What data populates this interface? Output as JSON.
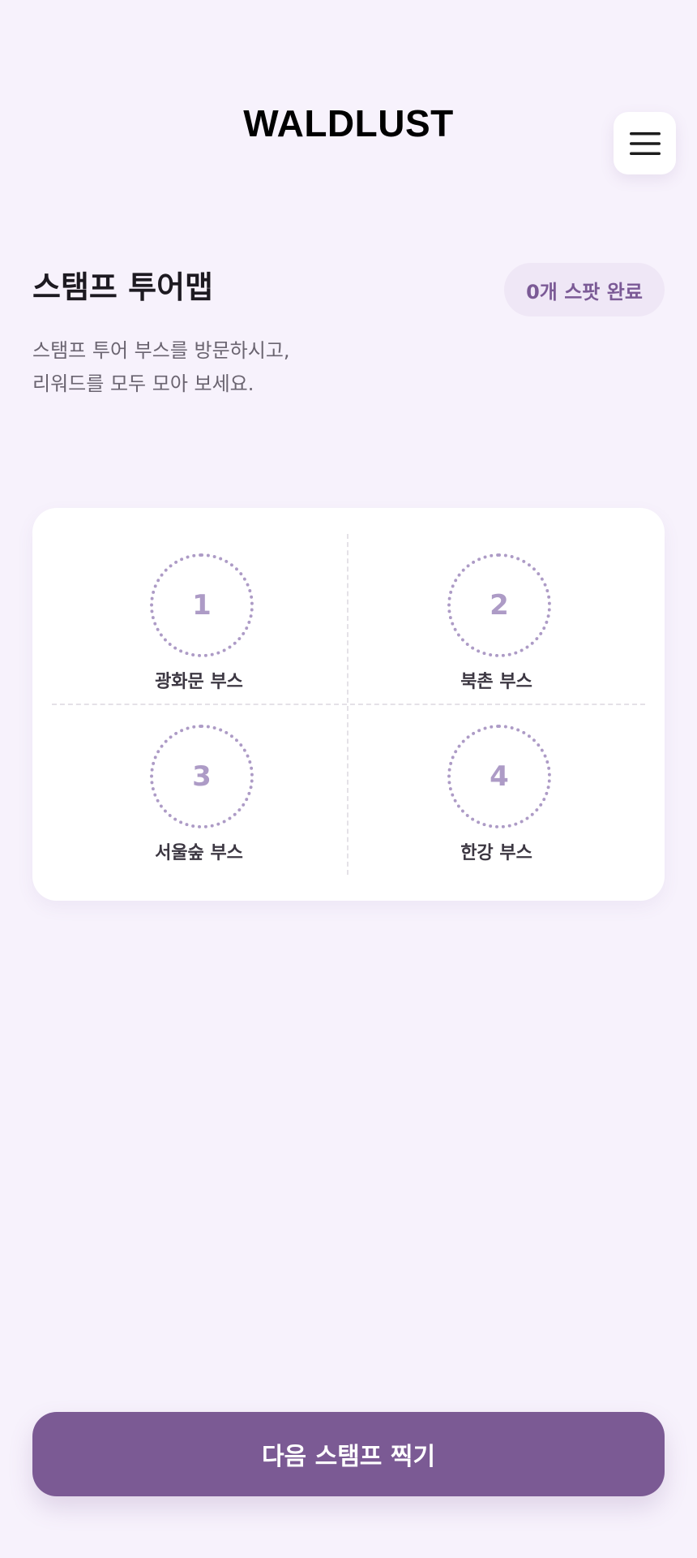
{
  "header": {
    "logo": "WALDLUST",
    "menu_icon": "hamburger-menu-icon"
  },
  "intro": {
    "title": "스탬프 투어맵",
    "badge": "0개 스팟 완료",
    "subtitle_lines": [
      "스탬프 투어 부스를 방문하시고,",
      "리워드를 모두 모아 보세요."
    ]
  },
  "stamp_map": {
    "spots": [
      {
        "number": "1",
        "label": "광화문 부스"
      },
      {
        "number": "2",
        "label": "북촌 부스"
      },
      {
        "number": "3",
        "label": "서울숲 부스"
      },
      {
        "number": "4",
        "label": "한강 부스"
      }
    ]
  },
  "cta": {
    "label": "다음 스탬프 찍기"
  },
  "colors": {
    "background": "#f7f2fc",
    "accent": "#7b5a94",
    "badge_bg": "#efe7f6",
    "stamp_outline": "#ad9bc6"
  }
}
